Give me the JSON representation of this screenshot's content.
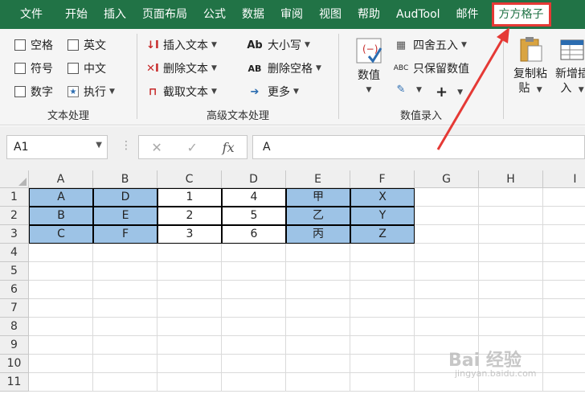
{
  "ribbon_tabs": [
    "文件",
    "开始",
    "插入",
    "页面布局",
    "公式",
    "数据",
    "审阅",
    "视图",
    "帮助",
    "AudTool",
    "邮件",
    "方方格子"
  ],
  "active_tab": "方方格子",
  "group_text_processing": {
    "label": "文本处理",
    "checkboxes": [
      "空格",
      "英文",
      "符号",
      "中文",
      "数字"
    ],
    "execute_label": "执行"
  },
  "group_advanced_text": {
    "label": "高级文本处理",
    "insert_text": "插入文本",
    "delete_text": "删除文本",
    "extract_text": "截取文本",
    "case_label": "大小写",
    "case_icon_text": "Ab",
    "delete_spaces": "删除空格",
    "delete_spaces_icon_text": "AB",
    "more_label": "更多"
  },
  "group_numeric": {
    "label": "数值录入",
    "numeric_btn": "数值",
    "round_label": "四舍五入",
    "keep_numeric": "只保留数值",
    "keep_numeric_icon_text": "ABC",
    "plus_label": "+"
  },
  "group_copy": {
    "copy_paste_line1": "复制粘",
    "copy_paste_line2": "贴",
    "new_add_line1": "新增插",
    "new_add_line2": "入"
  },
  "formula_bar": {
    "name_box": "A1",
    "cancel_icon": "✕",
    "enter_icon": "✓",
    "fx_label": "fx",
    "formula": "A"
  },
  "sheet": {
    "columns": [
      "A",
      "B",
      "C",
      "D",
      "E",
      "F",
      "G",
      "H",
      "I"
    ],
    "rows": [
      "1",
      "2",
      "3",
      "4",
      "5",
      "6",
      "7",
      "8",
      "9",
      "10",
      "11"
    ],
    "data": [
      [
        "A",
        "D",
        "1",
        "4",
        "甲",
        "X"
      ],
      [
        "B",
        "E",
        "2",
        "5",
        "乙",
        "Y"
      ],
      [
        "C",
        "F",
        "3",
        "6",
        "丙",
        "Z"
      ]
    ]
  },
  "watermark": {
    "brand": "Bai 经验",
    "url": "jingyan.baidu.com"
  },
  "colors": {
    "ribbon_green": "#217346",
    "highlight_red": "#e53935",
    "cell_blue": "#9dc3e6"
  }
}
